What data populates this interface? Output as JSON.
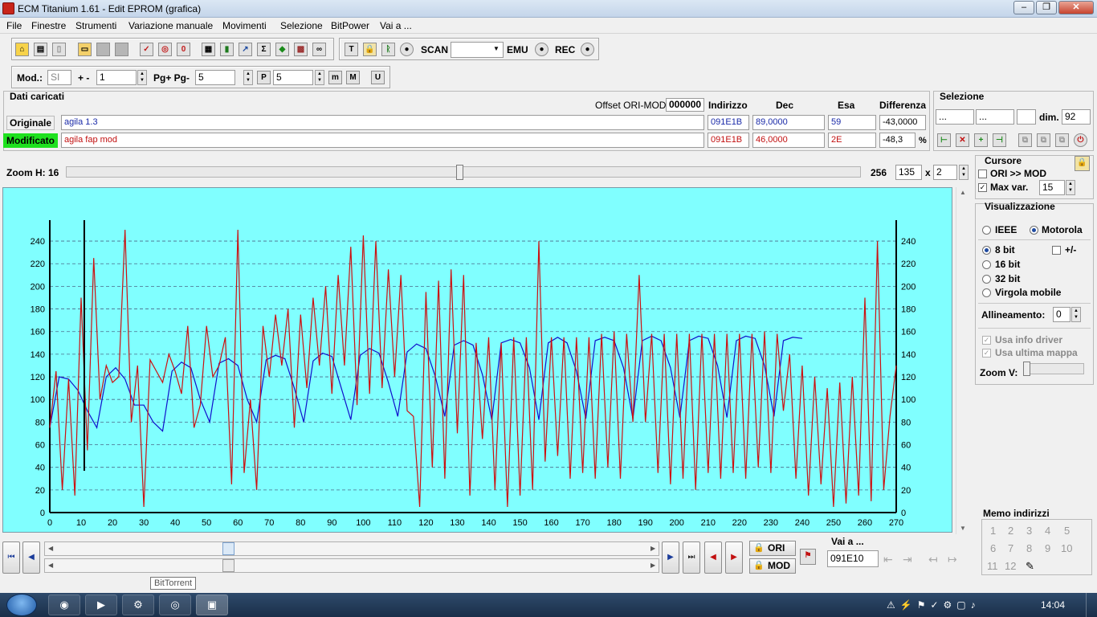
{
  "window": {
    "title": "ECM Titanium 1.61 - Edit EPROM (grafica)",
    "buttons": [
      "‒",
      "❐",
      "✕"
    ]
  },
  "menu": [
    "File",
    "Finestre",
    "Strumenti",
    "Variazione manuale",
    "Movimenti",
    "Selezione",
    "BitPower",
    "Vai a ..."
  ],
  "toolbar": {
    "scan": "SCAN",
    "emu": "EMU",
    "rec": "REC",
    "scan_select": ""
  },
  "toolbar2": {
    "mod_label": "Mod.:",
    "mod_value": "SI",
    "plusminus_label": "+ -",
    "plusminus_value": "1",
    "pg_label": "Pg+ Pg-",
    "pg_value": "5",
    "p_value": "5"
  },
  "dati": {
    "title": "Dati caricati",
    "offset_label": "Offset ORI-MOD",
    "offset_value": "000000",
    "headers": {
      "indirizzo": "Indirizzo",
      "dec": "Dec",
      "esa": "Esa",
      "diff": "Differenza"
    },
    "originale": {
      "label": "Originale",
      "name": "agila 1.3",
      "addr": "091E1B",
      "dec": "89,0000",
      "esa": "59",
      "diff": "-43,0000"
    },
    "modificato": {
      "label": "Modificato",
      "name": "agila fap mod",
      "addr": "091E1B",
      "dec": "46,0000",
      "esa": "2E",
      "diff": "-48,3",
      "pct": "%"
    }
  },
  "selezione": {
    "title": "Selezione",
    "f1": "...",
    "f2": "...",
    "dim_label": "dim.",
    "dim_value": "92"
  },
  "zoom": {
    "label": "Zoom H: 16",
    "max": "256",
    "value": "135",
    "x": "x",
    "mult": "2"
  },
  "cursore": {
    "title": "Cursore",
    "ori_mod": "ORI >> MOD",
    "maxvar": "Max var.",
    "maxvar_value": "15"
  },
  "vis": {
    "title": "Visualizzazione",
    "ieee": "IEEE",
    "motorola": "Motorola",
    "bit8": "8 bit",
    "bit16": "16 bit",
    "bit32": "32 bit",
    "virgola": "Virgola mobile",
    "signed": "+/-",
    "allineamento": "Allineamento:",
    "allin_value": "0",
    "usa_driver": "Usa info driver",
    "usa_mappa": "Usa ultima mappa",
    "zoomv": "Zoom V:"
  },
  "memo": {
    "title": "Memo indirizzi",
    "items": [
      "1",
      "2",
      "3",
      "4",
      "5",
      "6",
      "7",
      "8",
      "9",
      "10",
      "11",
      "12"
    ]
  },
  "bottom": {
    "vai_label": "Vai a ...",
    "vai_value": "091E10",
    "ori": "ORI",
    "mod": "MOD",
    "tooltip": "BitTorrent"
  },
  "taskbar": {
    "time": "14:04"
  },
  "colors": {
    "plot_bg": "#80ffff",
    "ori_line": "#1010cc",
    "mod_line": "#cc1010",
    "grid": "#4a6a8a"
  },
  "chart_data": {
    "type": "line",
    "title": "",
    "xlabel": "",
    "ylabel": "",
    "xlim": [
      0,
      270
    ],
    "ylim": [
      0,
      250
    ],
    "x_ticks": [
      0,
      10,
      20,
      30,
      40,
      50,
      60,
      70,
      80,
      90,
      100,
      110,
      120,
      130,
      140,
      150,
      160,
      170,
      180,
      190,
      200,
      210,
      220,
      230,
      240,
      250,
      260,
      270
    ],
    "y_ticks": [
      0,
      20,
      40,
      60,
      80,
      100,
      120,
      140,
      160,
      180,
      200,
      220,
      240
    ],
    "grid": "horizontal dashed",
    "cursor_x": 11,
    "series": [
      {
        "name": "ORI",
        "color": "#1010cc",
        "x": [
          0,
          3,
          6,
          9,
          12,
          15,
          18,
          21,
          24,
          27,
          30,
          33,
          36,
          39,
          42,
          45,
          48,
          51,
          54,
          57,
          60,
          63,
          66,
          69,
          72,
          75,
          78,
          81,
          84,
          87,
          90,
          93,
          96,
          99,
          102,
          105,
          108,
          111,
          114,
          117,
          120,
          123,
          126,
          129,
          132,
          135,
          138,
          141,
          144,
          147,
          150,
          153,
          156,
          159,
          162,
          165,
          168,
          171,
          174,
          177,
          180,
          183,
          186,
          189,
          192,
          195,
          198,
          201,
          204,
          207,
          210,
          213,
          216,
          219,
          222,
          225,
          228,
          231,
          234,
          237,
          240
        ],
        "y": [
          75,
          120,
          118,
          108,
          90,
          75,
          120,
          128,
          118,
          95,
          95,
          80,
          72,
          125,
          133,
          128,
          100,
          80,
          132,
          136,
          130,
          100,
          80,
          135,
          139,
          136,
          110,
          80,
          134,
          141,
          138,
          110,
          82,
          139,
          145,
          141,
          115,
          85,
          142,
          149,
          145,
          120,
          85,
          148,
          152,
          148,
          122,
          82,
          150,
          153,
          150,
          128,
          82,
          150,
          155,
          150,
          125,
          83,
          152,
          155,
          152,
          128,
          83,
          152,
          156,
          152,
          128,
          84,
          152,
          156,
          154,
          130,
          84,
          152,
          156,
          154,
          130,
          85,
          152,
          155,
          154
        ]
      },
      {
        "name": "MOD",
        "color": "#cc1010",
        "x": [
          0,
          2,
          4,
          6,
          8,
          10,
          12,
          14,
          16,
          18,
          20,
          22,
          24,
          26,
          28,
          30,
          32,
          34,
          36,
          38,
          40,
          42,
          44,
          46,
          48,
          50,
          52,
          54,
          56,
          58,
          60,
          62,
          64,
          66,
          68,
          70,
          72,
          74,
          76,
          78,
          80,
          82,
          84,
          86,
          88,
          90,
          92,
          94,
          96,
          98,
          100,
          102,
          104,
          106,
          108,
          110,
          112,
          114,
          116,
          118,
          120,
          122,
          124,
          126,
          128,
          130,
          132,
          134,
          136,
          138,
          140,
          142,
          144,
          146,
          148,
          150,
          152,
          154,
          156,
          158,
          160,
          162,
          164,
          166,
          168,
          170,
          172,
          174,
          176,
          178,
          180,
          182,
          184,
          186,
          188,
          190,
          192,
          194,
          196,
          198,
          200,
          202,
          204,
          206,
          208,
          210,
          212,
          214,
          216,
          218,
          220,
          222,
          224,
          226,
          228,
          230,
          232,
          234,
          236,
          238,
          240,
          242,
          244,
          246,
          248,
          250,
          252,
          254,
          256,
          258,
          260,
          262,
          264,
          266,
          268,
          270
        ],
        "y": [
          75,
          125,
          20,
          118,
          15,
          190,
          55,
          225,
          100,
          130,
          115,
          120,
          250,
          80,
          130,
          5,
          135,
          125,
          115,
          140,
          125,
          105,
          165,
          75,
          95,
          165,
          120,
          130,
          155,
          25,
          250,
          35,
          100,
          20,
          165,
          120,
          175,
          130,
          180,
          75,
          175,
          110,
          190,
          130,
          200,
          105,
          210,
          130,
          235,
          95,
          245,
          105,
          240,
          110,
          215,
          120,
          210,
          90,
          85,
          5,
          195,
          40,
          205,
          30,
          215,
          70,
          210,
          15,
          150,
          65,
          155,
          20,
          150,
          5,
          155,
          15,
          155,
          20,
          240,
          45,
          155,
          50,
          155,
          30,
          155,
          35,
          155,
          30,
          158,
          40,
          160,
          30,
          158,
          80,
          210,
          80,
          158,
          35,
          158,
          25,
          158,
          30,
          158,
          20,
          158,
          35,
          158,
          30,
          158,
          35,
          158,
          30,
          158,
          40,
          160,
          35,
          158,
          90,
          140,
          30,
          130,
          15,
          120,
          25,
          110,
          5,
          115,
          8,
          120,
          15,
          190,
          10,
          240,
          20,
          85,
          130
        ]
      }
    ]
  }
}
